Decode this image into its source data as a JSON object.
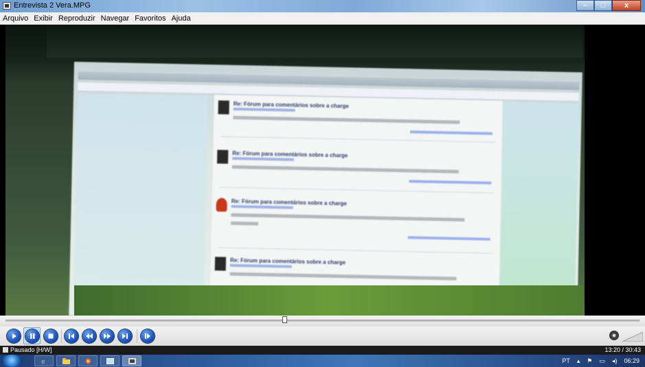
{
  "window": {
    "title": "Entrevista 2 Vera.MPG",
    "buttons": {
      "minimize": "–",
      "maximize": "□",
      "close": "x"
    }
  },
  "menu": [
    "Arquivo",
    "Exibir",
    "Reproduzir",
    "Navegar",
    "Favoritos",
    "Ajuda"
  ],
  "video": {
    "posts": [
      {
        "subject": "Re: Fórum para comentários sobre a charge"
      },
      {
        "subject": "Re: Fórum para comentários sobre a charge"
      },
      {
        "subject": "Re: Fórum para comentários sobre a charge"
      },
      {
        "subject": "Re: Fórum para comentários sobre a charge"
      }
    ]
  },
  "seek": {
    "progress": 0.44
  },
  "controls": {
    "buttons": [
      "play-icon",
      "pause-icon",
      "stop-icon",
      "previous-chapter-icon",
      "rewind-icon",
      "fast-forward-icon",
      "next-chapter-icon",
      "step-frame-icon"
    ]
  },
  "status": {
    "state": "Pausado [H/W]",
    "time": "13:20 / 30:43"
  },
  "taskbar": {
    "tray_language": "PT",
    "clock": "06:29"
  }
}
